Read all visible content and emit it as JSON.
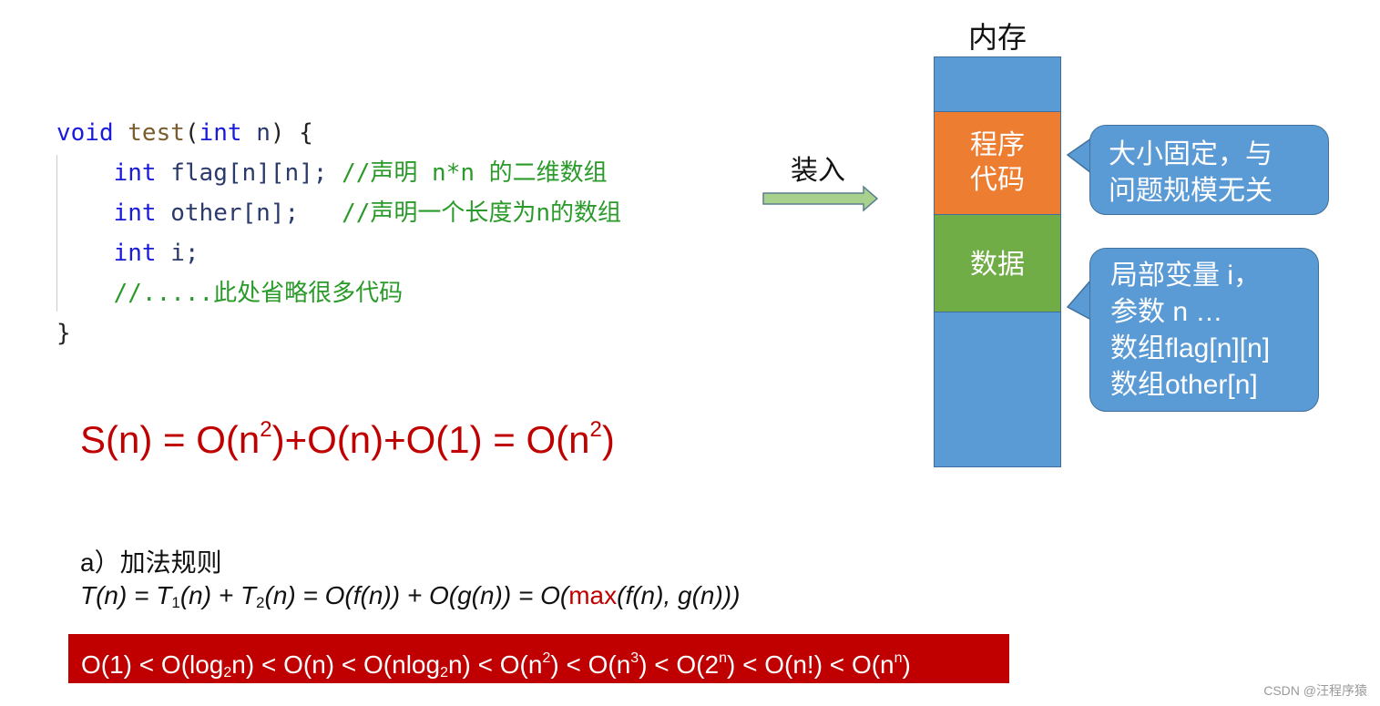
{
  "code": {
    "lines": [
      [
        {
          "t": "void ",
          "c": "kw"
        },
        {
          "t": "test",
          "c": "fn"
        },
        {
          "t": "(",
          "c": "pl"
        },
        {
          "t": "int ",
          "c": "kw"
        },
        {
          "t": "n",
          "c": "id"
        },
        {
          "t": ") {",
          "c": "pl"
        }
      ],
      [
        {
          "t": "    int ",
          "c": "kw"
        },
        {
          "t": "flag[n][n]; ",
          "c": "id"
        },
        {
          "t": "//声明 n*n 的二维数组",
          "c": "cm"
        }
      ],
      [
        {
          "t": "    int ",
          "c": "kw"
        },
        {
          "t": "other[n];   ",
          "c": "id"
        },
        {
          "t": "//声明一个长度为n的数组",
          "c": "cm"
        }
      ],
      [
        {
          "t": "    int ",
          "c": "kw"
        },
        {
          "t": "i;",
          "c": "id"
        }
      ],
      [
        {
          "t": "    //.....此处省略很多代码",
          "c": "cm"
        }
      ],
      [
        {
          "t": "}",
          "c": "pl"
        }
      ]
    ]
  },
  "space_formula": {
    "a": "S(n) = O(n",
    "b": "2",
    "c": ")+O(n)+O(1) = O(n",
    "d": "2",
    "e": ")"
  },
  "arrow_label": "装入",
  "memory": {
    "title": "内存",
    "code_segment": "程序\n代码",
    "data_segment": "数据",
    "colors": {
      "memory": "#5b9bd5",
      "code": "#ed7d31",
      "data": "#70ad47"
    }
  },
  "callouts": {
    "code_note": "大小固定，与\n问题规模无关",
    "data_note": "局部变量 i，\n参数 n …\n数组flag[n][n]\n数组other[n]"
  },
  "addition_rule": {
    "heading": "a）加法规则",
    "p1": "T(n) = T",
    "s1": "1",
    "p2": "(n) + T",
    "s2": "2",
    "p3": "(n) = O(f(n)) + O(g(n)) = O(",
    "max": "max",
    "p4": "(f(n), g(n)))"
  },
  "order": {
    "parts": [
      "O(1) < O(log",
      "2",
      "n) < O(n) < O(nlog",
      "2",
      "n) < O(n",
      "2",
      ") < O(n",
      "3",
      ") < O(2",
      "n",
      ") < O(n!) < O(n",
      "n",
      ")"
    ],
    "background": "#c00000"
  },
  "watermark": "CSDN @汪程序猿"
}
